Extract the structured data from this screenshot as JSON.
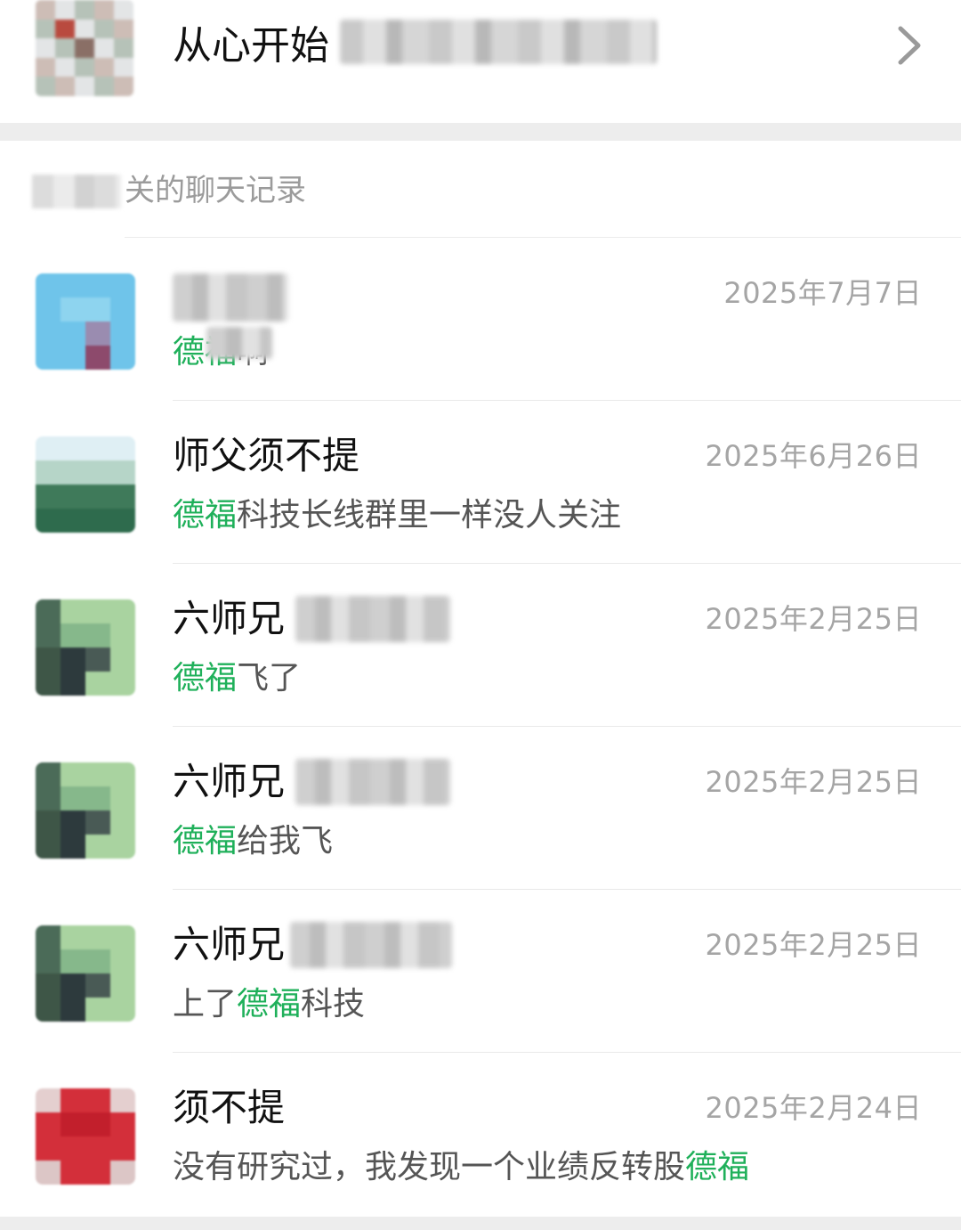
{
  "top_group": {
    "title": "从心开始"
  },
  "section": {
    "label": "关的聊天记录"
  },
  "records": [
    {
      "name": "",
      "date": "2025年7月7日",
      "msg_pre": "",
      "msg_hl": "德福",
      "msg_post": "啊"
    },
    {
      "name": "师父须不提",
      "date": "2025年6月26日",
      "msg_pre": "",
      "msg_hl": "德福",
      "msg_post": "科技长线群里一样没人关注"
    },
    {
      "name": "六师兄",
      "date": "2025年2月25日",
      "msg_pre": "",
      "msg_hl": "德福",
      "msg_post": "飞了"
    },
    {
      "name": "六师兄",
      "date": "2025年2月25日",
      "msg_pre": "",
      "msg_hl": "德福",
      "msg_post": "给我飞"
    },
    {
      "name": "六师兄",
      "date": "2025年2月25日",
      "msg_pre": "上了",
      "msg_hl": "德福",
      "msg_post": "科技"
    },
    {
      "name": "须不提",
      "date": "2025年2月24日",
      "msg_pre": "没有研究过，我发现一个业绩反转股",
      "msg_hl": "德福",
      "msg_post": ""
    }
  ],
  "colors": {
    "highlight": "#1fb05a",
    "date": "#a5a5a5",
    "separator": "#ededed"
  },
  "icons": {
    "chevron": "chevron-right-icon"
  }
}
